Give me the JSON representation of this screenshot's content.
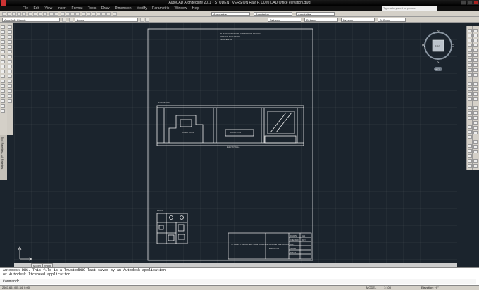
{
  "window": {
    "title": "AutoCAD Architecture 2011 - STUDENT VERSION    Ravi P. D020 CAD Office elevation.dwg"
  },
  "menu": [
    "File",
    "Edit",
    "View",
    "Insert",
    "Format",
    "Tools",
    "Draw",
    "Dimension",
    "Modify",
    "Parametric",
    "Window",
    "Help"
  ],
  "search": {
    "placeholder": "Type a keyword or phrase"
  },
  "toolbars": {
    "workspace": "AutoCAD Classic",
    "layer": "doors",
    "annotative": "Annotative",
    "bylayer_1": "ByLayer",
    "bylayer_2": "ByLayer",
    "bylayer_3": "ByLayer",
    "bycolor": "ByColor"
  },
  "palette": {
    "label": "Tool Palettes - All Palettes"
  },
  "viewcube": {
    "north": "N",
    "south": "S",
    "east": "E",
    "west": "W",
    "face": "TOP",
    "wcs": "WCS"
  },
  "drawing": {
    "header_lines": [
      "D. ARCHITECTURE & INTERIOR DESIGN",
      "OFFICE ELEVATION",
      "SCALE 1:50"
    ],
    "elev_label": "ELEVATION",
    "room_left": "BOARD ROOM",
    "room_mid": "RECEPTION",
    "elev_caption": "ELEV. AT WALL",
    "plan_label": "PLAN",
    "key": "KEY",
    "title_company": "STUDENT ARCHITECTURE COMPANY",
    "title_project": "OFFICE ELEVATION",
    "title_number": "A01",
    "title_drawing": "ELEVATION",
    "title_rows": [
      "DRAWN",
      "CHECKED",
      "DATE",
      "SCALE",
      "SHEET"
    ]
  },
  "tabs": {
    "model": "Model",
    "work": "Work"
  },
  "command": {
    "history": [
      "Autodesk DWG.  This file is a TrustedDWG last saved by an Autodesk application",
      "or Autodesk licensed application."
    ],
    "prompt": "Command:"
  },
  "status": {
    "coords": "2567.65, 405.34, 0.00",
    "model": "MODEL",
    "scale": "1:100",
    "elevation": "Elevation: +0\""
  }
}
